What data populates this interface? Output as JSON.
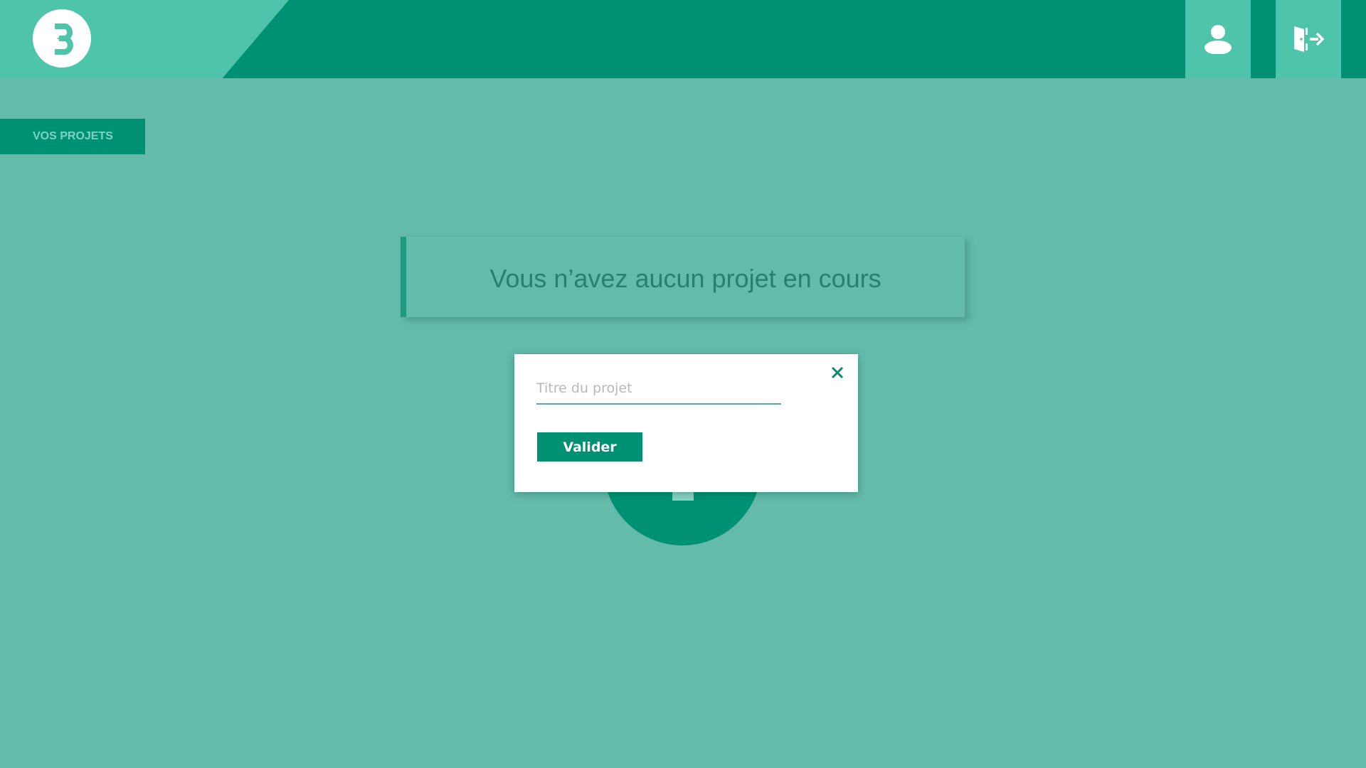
{
  "header": {
    "logo_icon": "brand-logo-icon",
    "user_button_icon": "user-icon",
    "logout_button_icon": "logout-door-icon"
  },
  "sidebar": {
    "projects_tab_label": "VOS PROJETS"
  },
  "main": {
    "empty_message": "Vous n’avez aucun projet en cours",
    "add_button_icon": "plus-icon"
  },
  "modal": {
    "title_input": {
      "value": "",
      "placeholder": "Titre du projet"
    },
    "submit_label": "Valider",
    "close_icon": "close-icon"
  },
  "colors": {
    "background": "#64bbaa",
    "header": "#009174",
    "header_accent": "#4ec4aa",
    "primary": "#009174",
    "text_dark_green": "#2a7f6d"
  }
}
